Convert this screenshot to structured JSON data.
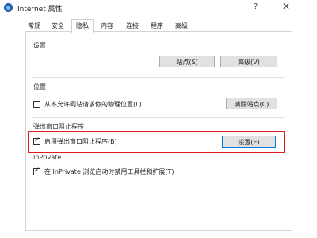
{
  "window": {
    "title": "Internet 属性",
    "help_glyph": "?",
    "close_glyph": "✕"
  },
  "tabs": [
    {
      "label": "常规",
      "active": false
    },
    {
      "label": "安全",
      "active": false
    },
    {
      "label": "隐私",
      "active": true
    },
    {
      "label": "内容",
      "active": false
    },
    {
      "label": "连接",
      "active": false
    },
    {
      "label": "程序",
      "active": false
    },
    {
      "label": "高级",
      "active": false
    }
  ],
  "settings_section": {
    "label": "设置",
    "sites_button": "站点(S)",
    "advanced_button": "高级(V)"
  },
  "location_section": {
    "label": "位置",
    "checkbox_label": "从不允许网站请求你的物理位置(L)",
    "checkbox_checked": false,
    "clear_sites_button": "清除站点(C)"
  },
  "popup_section": {
    "label": "弹出窗口阻止程序",
    "checkbox_label": "启用弹出窗口阻止程序(B)",
    "checkbox_checked": true,
    "settings_button": "设置(E)"
  },
  "inprivate_section": {
    "label": "InPrivate",
    "checkbox_label": "在 InPrivate 浏览启动时禁用工具栏和扩展(T)",
    "checkbox_checked": true
  },
  "colors": {
    "highlight": "#e31b23",
    "focus": "#0078d7",
    "icon_blue": "#1e5fa8"
  }
}
